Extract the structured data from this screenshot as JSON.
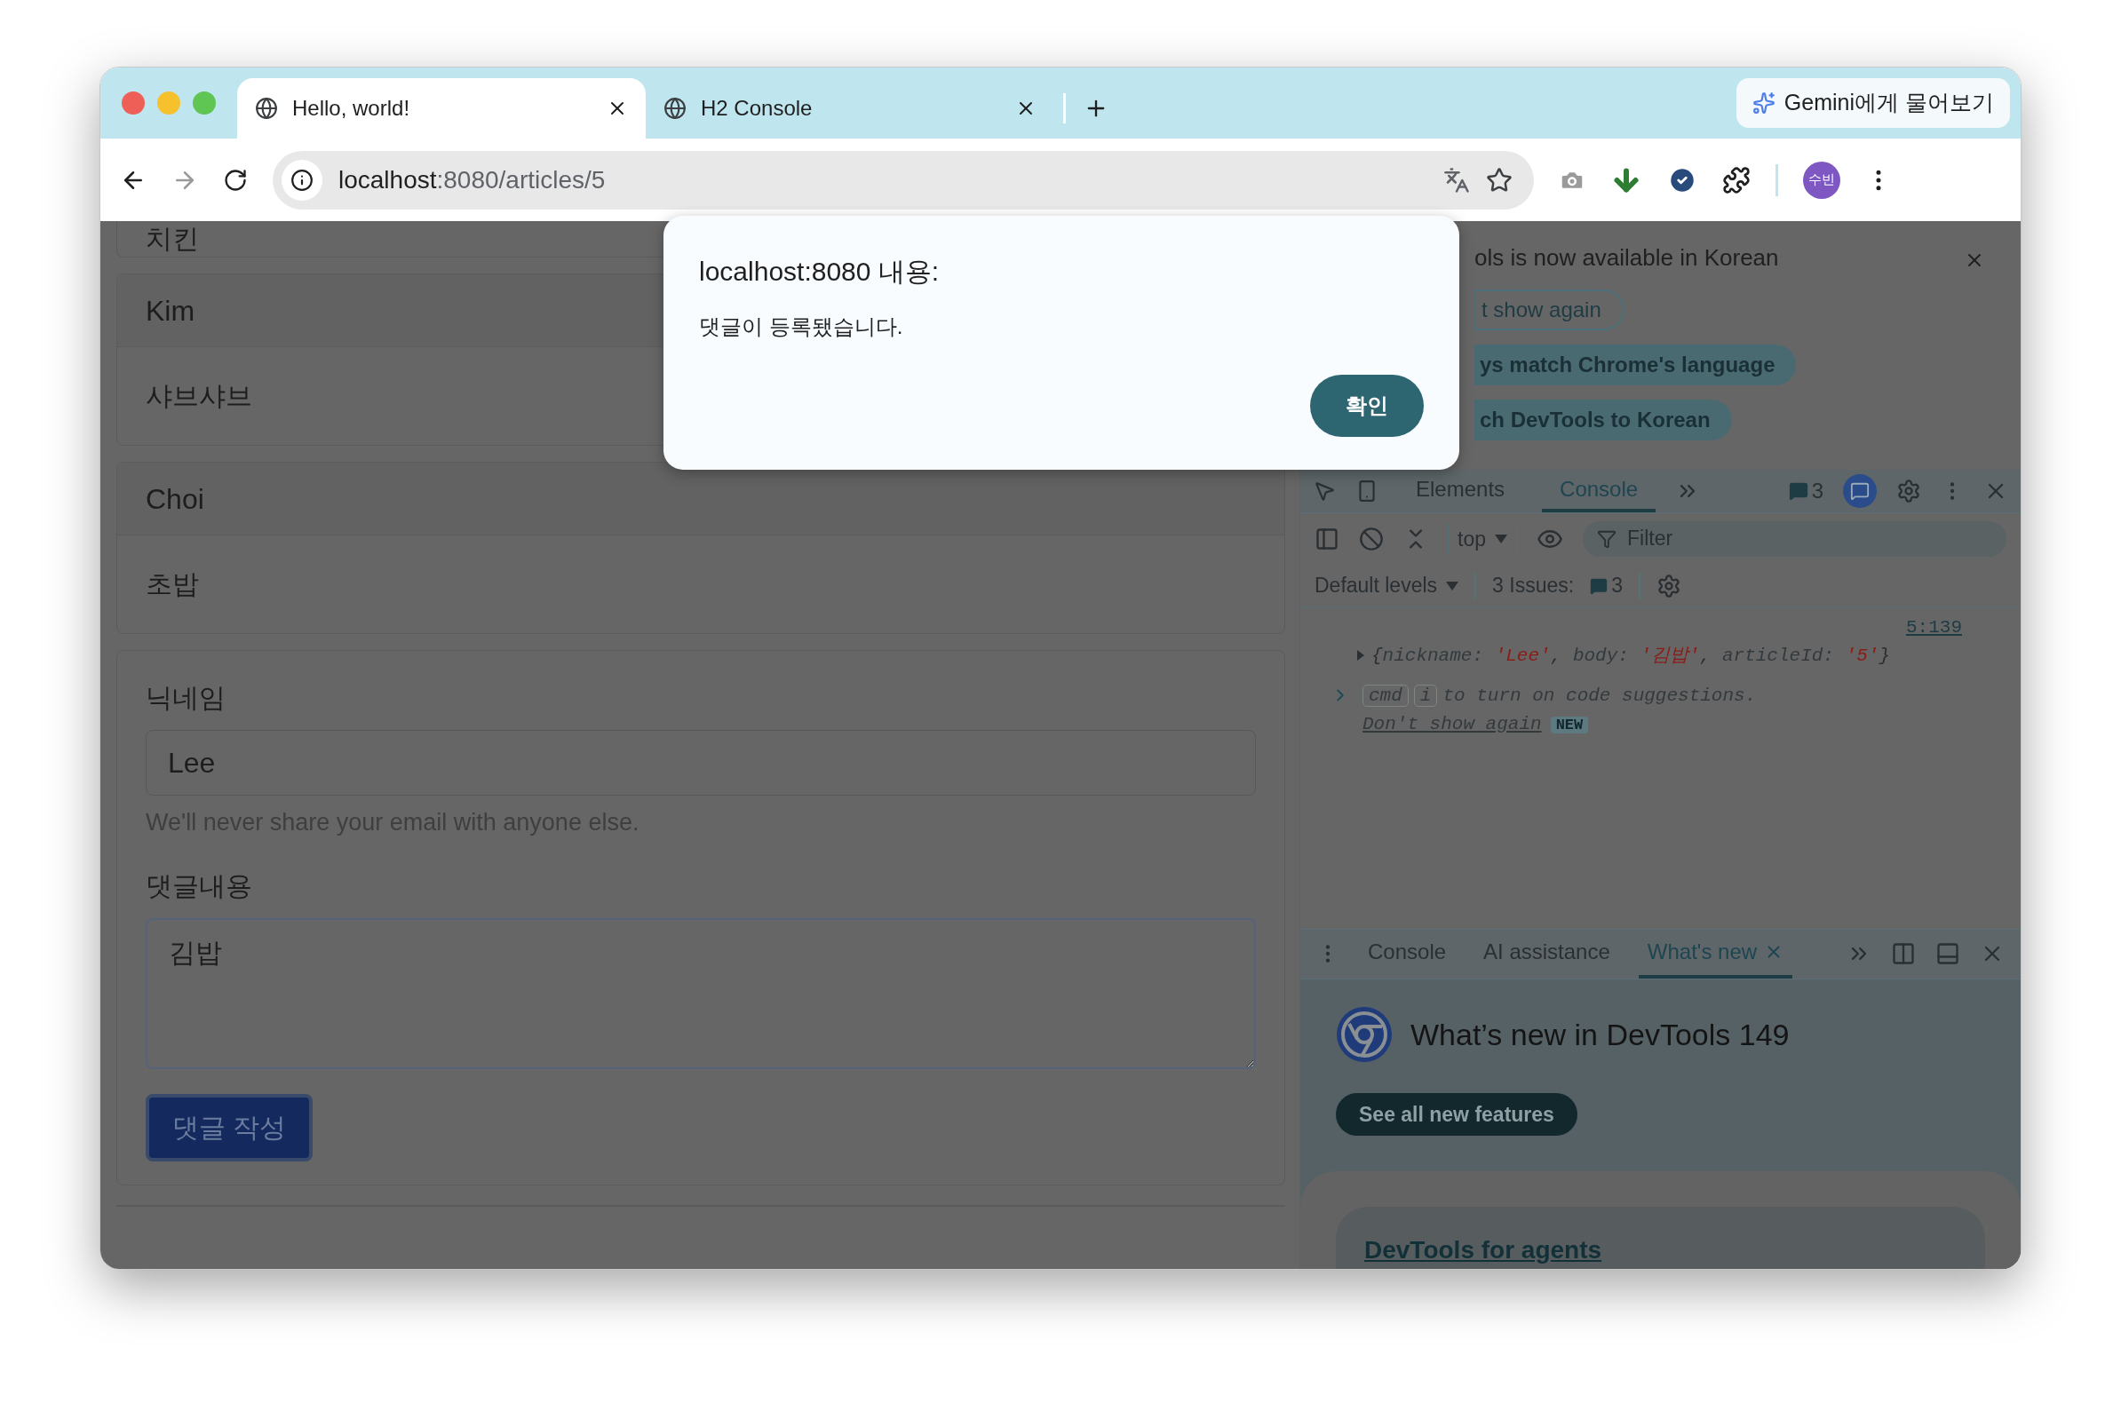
{
  "browser": {
    "tabs": [
      {
        "title": "Hello, world!",
        "selected": true
      },
      {
        "title": "H2 Console",
        "selected": false
      }
    ],
    "gemini_button": "Gemini에게 물어보기",
    "address": {
      "host": "localhost",
      "rest": ":8080/articles/5"
    },
    "profile": "수빈"
  },
  "page": {
    "comments": [
      {
        "body": "치킨"
      },
      {
        "nickname": "Kim",
        "body": "샤브샤브"
      },
      {
        "nickname": "Choi",
        "body": "초밥"
      }
    ],
    "form": {
      "nickname_label": "닉네임",
      "nickname_value": "Lee",
      "help": "We'll never share your email with anyone else.",
      "body_label": "댓글내용",
      "body_value": "김밥",
      "submit": "댓글 작성"
    }
  },
  "dialog": {
    "title": "localhost:8080 내용:",
    "message": "댓글이 등록됐습니다.",
    "ok": "확인"
  },
  "devtools": {
    "banner": {
      "message": "ols is now available in Korean",
      "buttons": [
        {
          "label": "t show again",
          "kind": "outline"
        },
        {
          "label": "ys match Chrome's language",
          "kind": "filled"
        },
        {
          "label": "ch DevTools to Korean",
          "kind": "filled"
        }
      ]
    },
    "tabs": [
      {
        "label": "Elements",
        "selected": false
      },
      {
        "label": "Console",
        "selected": true
      }
    ],
    "message_count": "3",
    "context": "top",
    "filter_placeholder": "Filter",
    "levels": "Default levels",
    "issues_label": "3 Issues:",
    "issues_count": "3",
    "source_link": "5:139",
    "log": {
      "open": "{",
      "fields": [
        {
          "key": "nickname:",
          "value": "'Lee'"
        },
        {
          "key": "body:",
          "value": "'김밥'"
        },
        {
          "key": "articleId:",
          "value": "'5'"
        }
      ],
      "separator": ",",
      "close": "}"
    },
    "hint": {
      "keys": [
        "cmd",
        "i"
      ],
      "text": "to turn on code suggestions.",
      "link": "Don't show again",
      "badge": "NEW"
    },
    "drawer_tabs": [
      {
        "label": "Console",
        "selected": false
      },
      {
        "label": "AI assistance",
        "selected": false
      },
      {
        "label": "What's new",
        "selected": true
      }
    ],
    "whats_new": {
      "heading": "What’s new in DevTools 149",
      "button": "See all new features",
      "card_link": "DevTools for agents"
    }
  }
}
